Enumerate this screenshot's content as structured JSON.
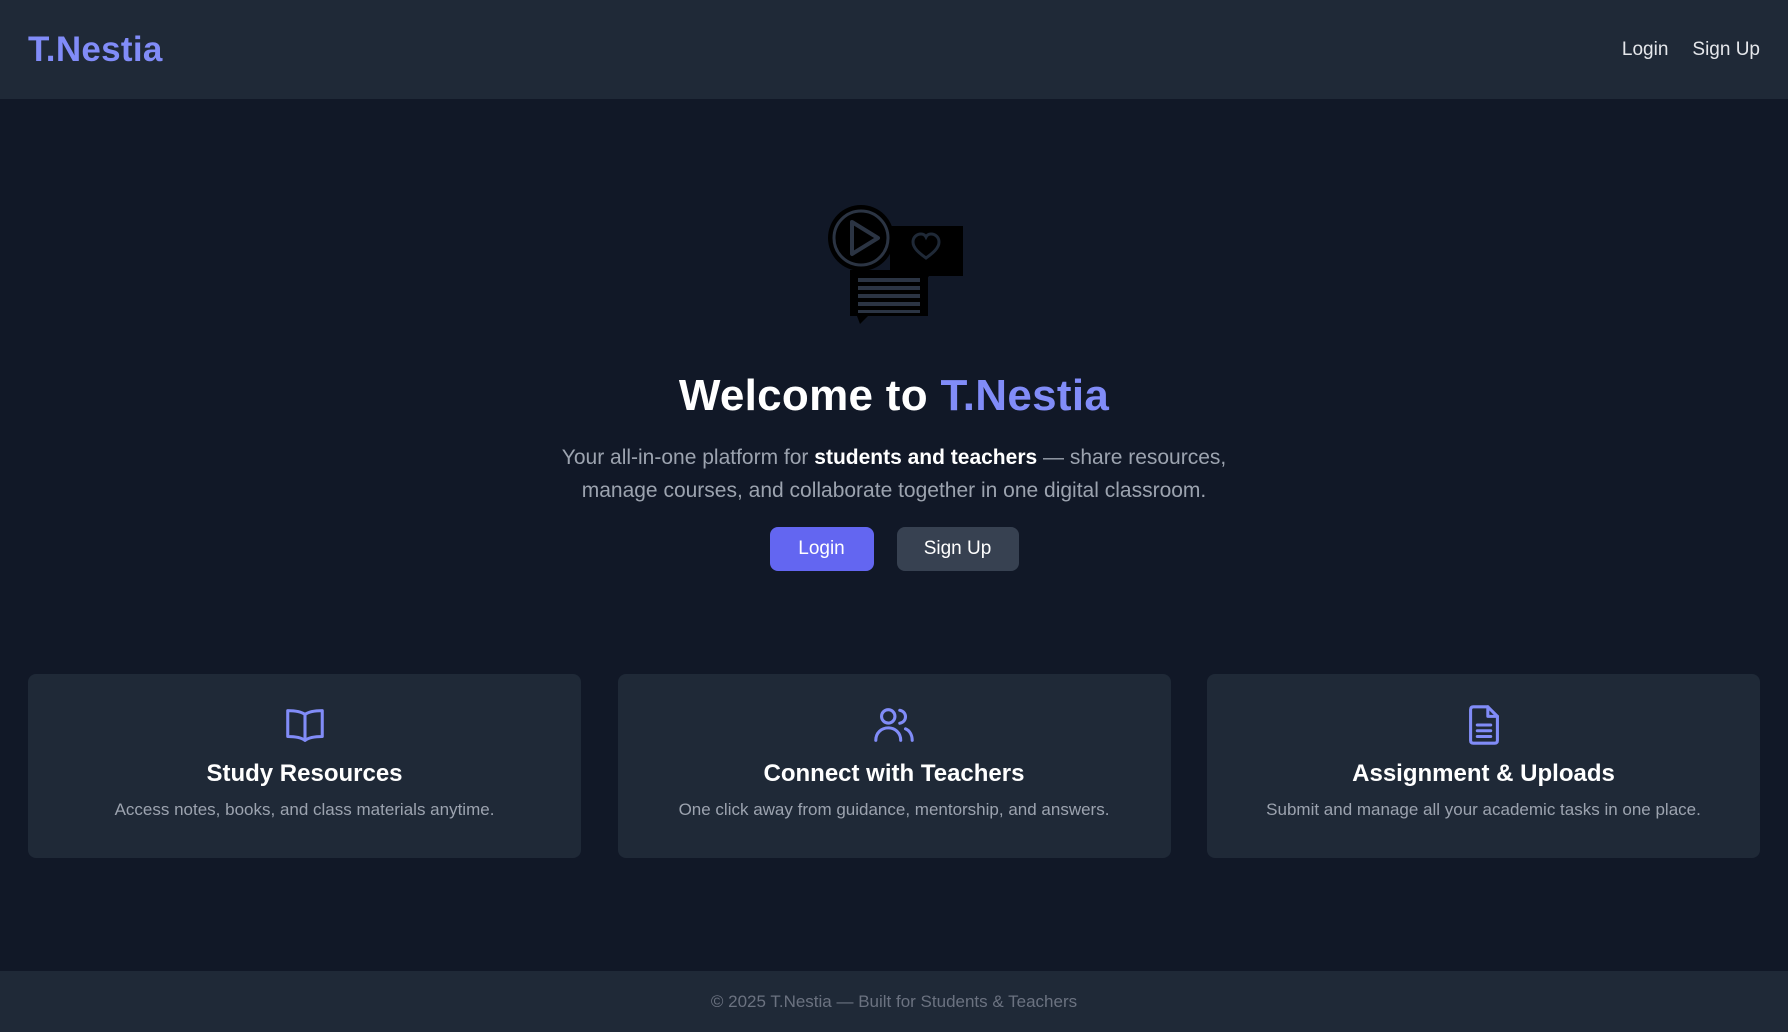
{
  "header": {
    "brand": "T.Nestia",
    "nav": [
      {
        "label": "Login"
      },
      {
        "label": "Sign Up"
      }
    ]
  },
  "hero": {
    "logo_icon": "video-chat-heart-icon",
    "title_prefix": "Welcome to ",
    "title_brand": "T.Nestia",
    "subtitle_before": "Your all-in-one platform for ",
    "subtitle_bold": "students and teachers",
    "subtitle_after": " — share resources, manage courses, and collaborate together in one digital classroom.",
    "login_label": "Login",
    "signup_label": "Sign Up"
  },
  "features": [
    {
      "icon": "book-open-icon",
      "title": "Study Resources",
      "description": "Access notes, books, and class materials anytime."
    },
    {
      "icon": "users-icon",
      "title": "Connect with Teachers",
      "description": "One click away from guidance, mentorship, and answers."
    },
    {
      "icon": "document-icon",
      "title": "Assignment & Uploads",
      "description": "Submit and manage all your academic tasks in one place."
    }
  ],
  "footer": {
    "text": "© 2025 T.Nestia — Built for Students & Teachers"
  },
  "colors": {
    "background": "#111827",
    "surface": "#1f2937",
    "accent": "#818cf8",
    "primary_button": "#6366f1",
    "secondary_button": "#374151",
    "muted_text": "#9ca3af"
  }
}
